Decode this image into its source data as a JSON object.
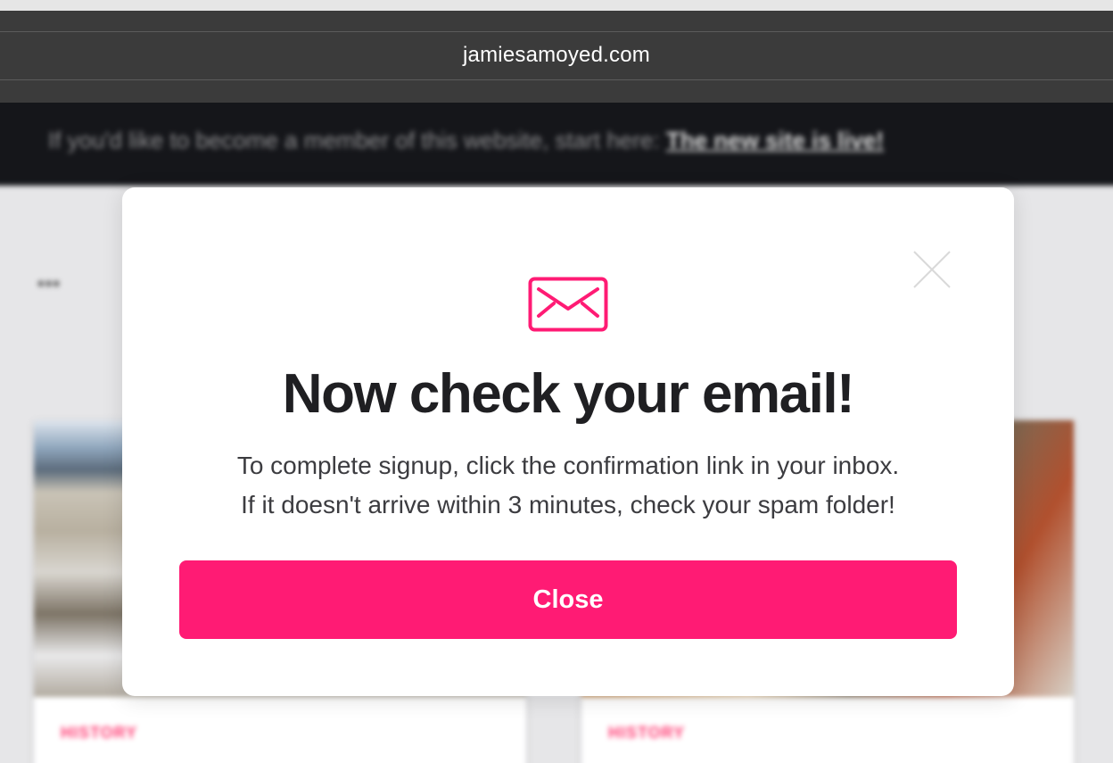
{
  "browser": {
    "url": "jamiesamoyed.com"
  },
  "background_page": {
    "banner_text": "If you'd like to become a member of this website, start here: ",
    "banner_link": "The new site is live!",
    "menu_dots": "•••",
    "cards": [
      {
        "category": "HISTORY"
      },
      {
        "category": "HISTORY"
      }
    ]
  },
  "modal": {
    "icon": "envelope-icon",
    "close_icon": "close-icon",
    "title": "Now check your email!",
    "message_line1": "To complete signup, click the confirmation link in your inbox.",
    "message_line2": "If it doesn't arrive within 3 minutes, check your spam folder!",
    "button_label": "Close"
  },
  "colors": {
    "accent": "#ff1b74",
    "title": "#1f1f22",
    "chrome": "#3b3b3b",
    "banner": "#15161a"
  }
}
